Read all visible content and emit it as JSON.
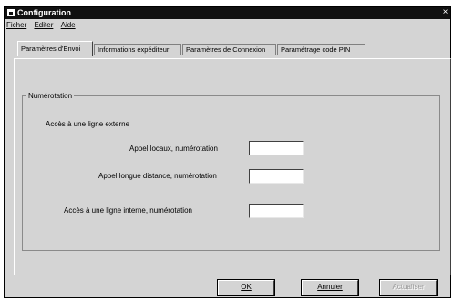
{
  "window": {
    "title": "Configuration",
    "close_glyph": "×"
  },
  "menu": [
    {
      "label": "Ficher"
    },
    {
      "label": "Editer"
    },
    {
      "label": "Aide"
    }
  ],
  "tabs": [
    {
      "label": "Paramètres d'Envoi",
      "active": true
    },
    {
      "label": "Informations expéditeur",
      "active": false
    },
    {
      "label": "Paramètres de Connexion",
      "active": false
    },
    {
      "label": "Paramétrage code PIN",
      "active": false
    }
  ],
  "group": {
    "title": "Numérotation",
    "heading": "Accès à une ligne externe",
    "fields": [
      {
        "label": "Appel locaux, numérotation",
        "value": ""
      },
      {
        "label": "Appel longue distance, numérotation",
        "value": ""
      },
      {
        "label": "Accès à une ligne interne, numérotation",
        "value": ""
      }
    ]
  },
  "buttons": {
    "ok": "OK",
    "cancel": "Annuler",
    "update": "Actualiser"
  }
}
